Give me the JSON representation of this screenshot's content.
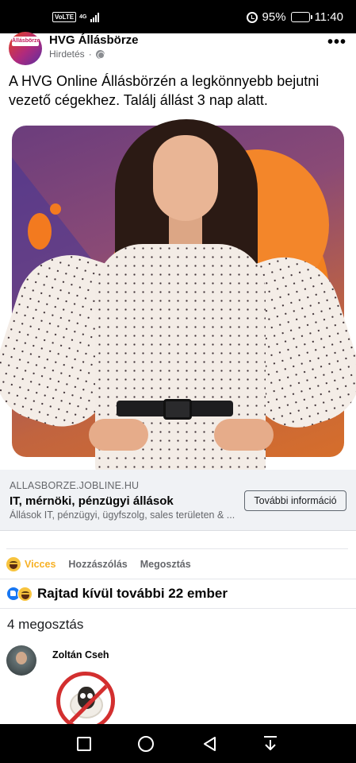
{
  "status_bar": {
    "volte": "VoLTE",
    "network": "4G",
    "battery_percent": "95%",
    "battery_level": 0.95,
    "time": "11:40"
  },
  "post": {
    "page_name": "HVG Állásbörze",
    "avatar_logo_text": "Állásbörze",
    "sponsored_label": "Hirdetés",
    "separator": "·",
    "text": "A HVG Online Állásbörzén a legkönnyebb bejutni vezető cégekhez. Találj állást 3 nap alatt."
  },
  "link_card": {
    "domain": "ALLASBORZE.JOBLINE.HU",
    "title": "IT, mérnöki, pénzügyi állások",
    "description": "Állások IT, pénzügyi, ügyfszolg, sales területen & ...",
    "cta_label": "További információ"
  },
  "actions": {
    "reaction_label": "Vicces",
    "comment_label": "Hozzászólás",
    "share_label": "Megosztás"
  },
  "reactions_summary": {
    "text": "Rajtad kívül további 22 ember"
  },
  "shares": {
    "text": "4 megosztás"
  },
  "comment": {
    "author": "Zoltán Cseh"
  },
  "colors": {
    "facebook_blue": "#1877f2",
    "haha_yellow": "#f7b125",
    "sticker_red": "#d32f2f"
  },
  "icons": [
    "page-logo-icon",
    "globe-icon",
    "more-options-icon",
    "haha-reaction-icon",
    "like-reaction-icon",
    "square-nav-icon",
    "home-nav-icon",
    "back-nav-icon",
    "notification-pull-icon"
  ]
}
